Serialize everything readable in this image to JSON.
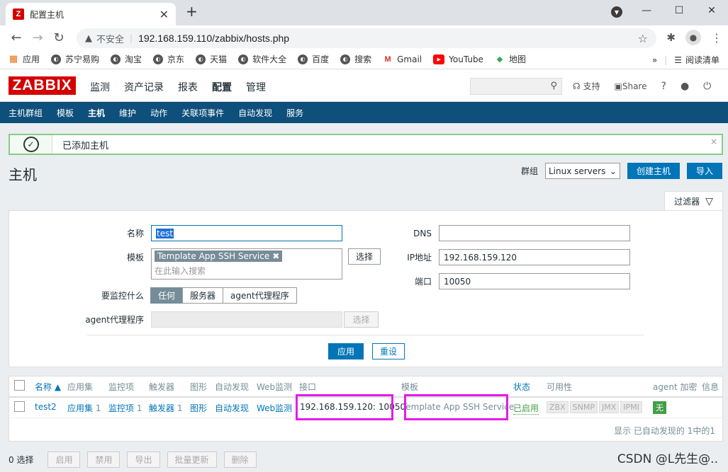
{
  "browser": {
    "tab_title": "配置主机",
    "favicon": "Z",
    "insecure_label": "不安全",
    "url": "192.168.159.110/zabbix/hosts.php",
    "bookmarks": [
      {
        "icon": "apps-grid-icon",
        "label": "应用"
      },
      {
        "icon": "globe-icon",
        "label": "苏宁易购"
      },
      {
        "icon": "globe-icon",
        "label": "淘宝"
      },
      {
        "icon": "globe-icon",
        "label": "京东"
      },
      {
        "icon": "globe-icon",
        "label": "天猫"
      },
      {
        "icon": "globe-icon",
        "label": "软件大全"
      },
      {
        "icon": "globe-icon",
        "label": "百度"
      },
      {
        "icon": "globe-icon",
        "label": "搜索"
      },
      {
        "icon": "gmail-icon",
        "label": "Gmail"
      },
      {
        "icon": "youtube-icon",
        "label": "YouTube"
      },
      {
        "icon": "maps-icon",
        "label": "地图"
      }
    ],
    "more": "»",
    "reading_list": "阅读清单"
  },
  "zabbix": {
    "logo": "ZABBIX",
    "menu": [
      "监测",
      "资产记录",
      "报表",
      "配置",
      "管理"
    ],
    "active_menu": "配置",
    "support": "支持",
    "share": "Share",
    "help": "?",
    "submenu": [
      "主机群组",
      "模板",
      "主机",
      "维护",
      "动作",
      "关联项事件",
      "自动发现",
      "服务"
    ],
    "active_submenu": "主机"
  },
  "message": {
    "text": "已添加主机",
    "close": "×"
  },
  "page": {
    "title": "主机",
    "group_label": "群组",
    "group_value": "Linux servers",
    "create_button": "创建主机",
    "import_button": "导入"
  },
  "filter": {
    "tab_label": "过滤器",
    "name_label": "名称",
    "name_value": "test",
    "template_label": "模板",
    "template_chip": "Template App SSH Service",
    "template_placeholder": "在此输入搜索",
    "select_button": "选择",
    "monitor_label": "要监控什么",
    "monitor_options": [
      "任何",
      "服务器",
      "agent代理程序"
    ],
    "proxy_label": "agent代理程序",
    "proxy_select": "选择",
    "dns_label": "DNS",
    "dns_value": "",
    "ip_label": "IP地址",
    "ip_value": "192.168.159.120",
    "port_label": "端口",
    "port_value": "10050",
    "apply": "应用",
    "reset": "重设"
  },
  "table": {
    "headers": [
      "名称 ▲",
      "应用集",
      "监控项",
      "触发器",
      "图形",
      "自动发现",
      "Web监测",
      "接口",
      "模板",
      "状态",
      "可用性",
      "agent 加密",
      "信息"
    ],
    "row": {
      "name": "test2",
      "apps": "应用集",
      "apps_count": "1",
      "items": "监控项",
      "items_count": "1",
      "triggers": "触发器",
      "triggers_count": "1",
      "graphs": "图形",
      "discovery": "自动发现",
      "web": "Web监测",
      "interface": "192.168.159.120: 10050",
      "template": "Template App SSH Service",
      "status": "已启用",
      "availability": [
        "ZBX",
        "SNMP",
        "JMX",
        "IPMI"
      ],
      "encryption": "无"
    },
    "footer": "显示 已自动发现的 1中的1"
  },
  "bottom": {
    "selected": "0 选择",
    "buttons": [
      "启用",
      "禁用",
      "导出",
      "批量更新",
      "删除"
    ]
  },
  "watermark": "CSDN @L先生@.."
}
